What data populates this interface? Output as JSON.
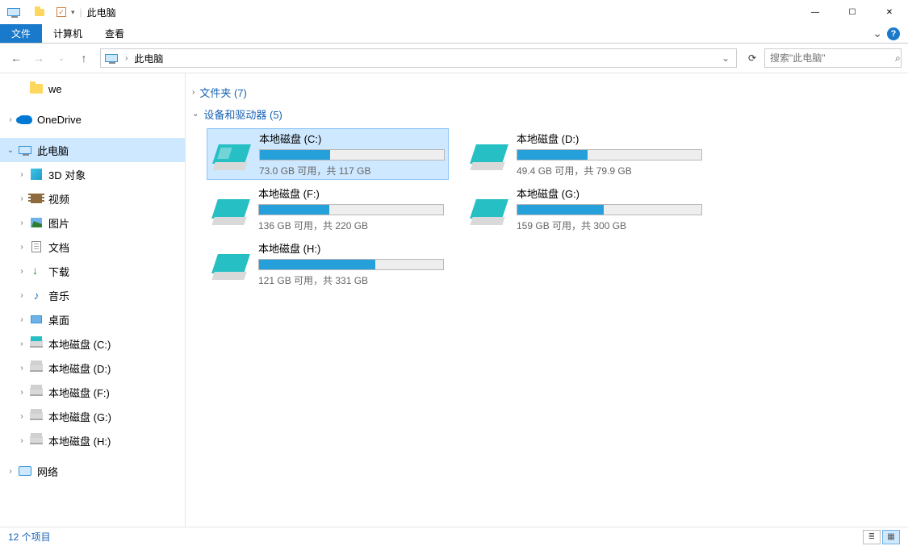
{
  "window": {
    "title": "此电脑",
    "minimize": "—",
    "maximize": "☐",
    "close": "✕"
  },
  "ribbon": {
    "file": "文件",
    "computer": "计算机",
    "view": "查看",
    "chevron": "⌄",
    "help": "?"
  },
  "nav": {
    "back": "←",
    "forward": "→",
    "recent_dd": "⌄",
    "up": "↑",
    "crumb_sep": "›",
    "crumb": "此电脑",
    "dropdown": "⌄",
    "refresh": "⟳",
    "search_placeholder": "搜索\"此电脑\"",
    "search_icon": "⌕"
  },
  "sidebar": {
    "we": "we",
    "onedrive": "OneDrive",
    "this_pc": "此电脑",
    "objects3d": "3D 对象",
    "videos": "视频",
    "pictures": "图片",
    "documents": "文档",
    "downloads": "下载",
    "music": "音乐",
    "desktop": "桌面",
    "disk_c": "本地磁盘 (C:)",
    "disk_d": "本地磁盘 (D:)",
    "disk_f": "本地磁盘 (F:)",
    "disk_g": "本地磁盘 (G:)",
    "disk_h": "本地磁盘 (H:)",
    "network": "网络"
  },
  "groups": {
    "folders": "文件夹 (7)",
    "devices": "设备和驱动器 (5)"
  },
  "drives": [
    {
      "name": "本地磁盘 (C:)",
      "stats": "73.0 GB 可用，共 117 GB",
      "fill": 38,
      "selected": true,
      "special": true
    },
    {
      "name": "本地磁盘 (D:)",
      "stats": "49.4 GB 可用，共 79.9 GB",
      "fill": 38,
      "selected": false,
      "special": false
    },
    {
      "name": "本地磁盘 (F:)",
      "stats": "136 GB 可用，共 220 GB",
      "fill": 38,
      "selected": false,
      "special": false
    },
    {
      "name": "本地磁盘 (G:)",
      "stats": "159 GB 可用，共 300 GB",
      "fill": 47,
      "selected": false,
      "special": false
    },
    {
      "name": "本地磁盘 (H:)",
      "stats": "121 GB 可用，共 331 GB",
      "fill": 63,
      "selected": false,
      "special": false
    }
  ],
  "status": {
    "items": "12 个项目"
  }
}
